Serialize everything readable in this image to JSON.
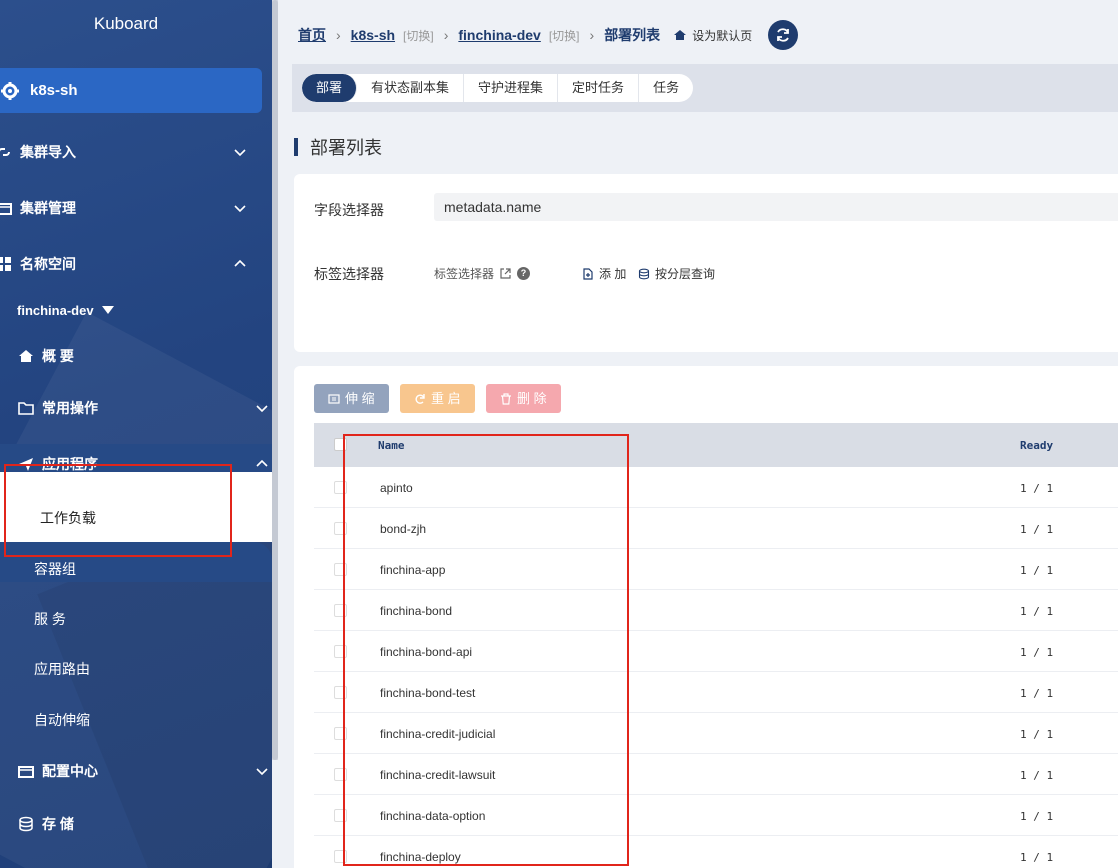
{
  "brand": "Kuboard",
  "sidebar": {
    "cluster": "k8s-sh",
    "items": [
      {
        "label": "集群导入"
      },
      {
        "label": "集群管理"
      },
      {
        "label": "名称空间"
      }
    ],
    "namespace": "finchina-dev",
    "overview": "概 要",
    "common_ops": "常用操作",
    "apps": "应用程序",
    "workloads": "工作负载",
    "sub_items": [
      "容器组",
      "服 务",
      "应用路由",
      "自动伸缩"
    ],
    "config_center": "配置中心",
    "storage": "存 储"
  },
  "breadcrumb": {
    "home": "首页",
    "cluster": "k8s-sh",
    "cluster_switch": "[切换]",
    "namespace": "finchina-dev",
    "namespace_switch": "[切换]",
    "current": "部署列表",
    "set_default": "设为默认页"
  },
  "tabs": [
    "部署",
    "有状态副本集",
    "守护进程集",
    "定时任务",
    "任务"
  ],
  "section_title": "部署列表",
  "filter": {
    "field_selector_label": "字段选择器",
    "field_selector_value": "metadata.name",
    "label_selector_label": "标签选择器",
    "label_selector_link": "标签选择器",
    "add": "添 加",
    "hierarchical_query": "按分层查询"
  },
  "actions": {
    "scale": "伸 缩",
    "restart": "重 启",
    "delete": "删 除"
  },
  "table": {
    "headers": {
      "name": "Name",
      "ready": "Ready"
    },
    "rows": [
      {
        "name": "apinto",
        "ready": "1 / 1"
      },
      {
        "name": "bond-zjh",
        "ready": "1 / 1"
      },
      {
        "name": "finchina-app",
        "ready": "1 / 1"
      },
      {
        "name": "finchina-bond",
        "ready": "1 / 1"
      },
      {
        "name": "finchina-bond-api",
        "ready": "1 / 1"
      },
      {
        "name": "finchina-bond-test",
        "ready": "1 / 1"
      },
      {
        "name": "finchina-credit-judicial",
        "ready": "1 / 1"
      },
      {
        "name": "finchina-credit-lawsuit",
        "ready": "1 / 1"
      },
      {
        "name": "finchina-data-option",
        "ready": "1 / 1"
      },
      {
        "name": "finchina-deploy",
        "ready": "1 / 1"
      }
    ]
  },
  "colors": {
    "navy": "#1f3c6e",
    "sidebar": "#234480",
    "highlight": "#e1251b"
  }
}
